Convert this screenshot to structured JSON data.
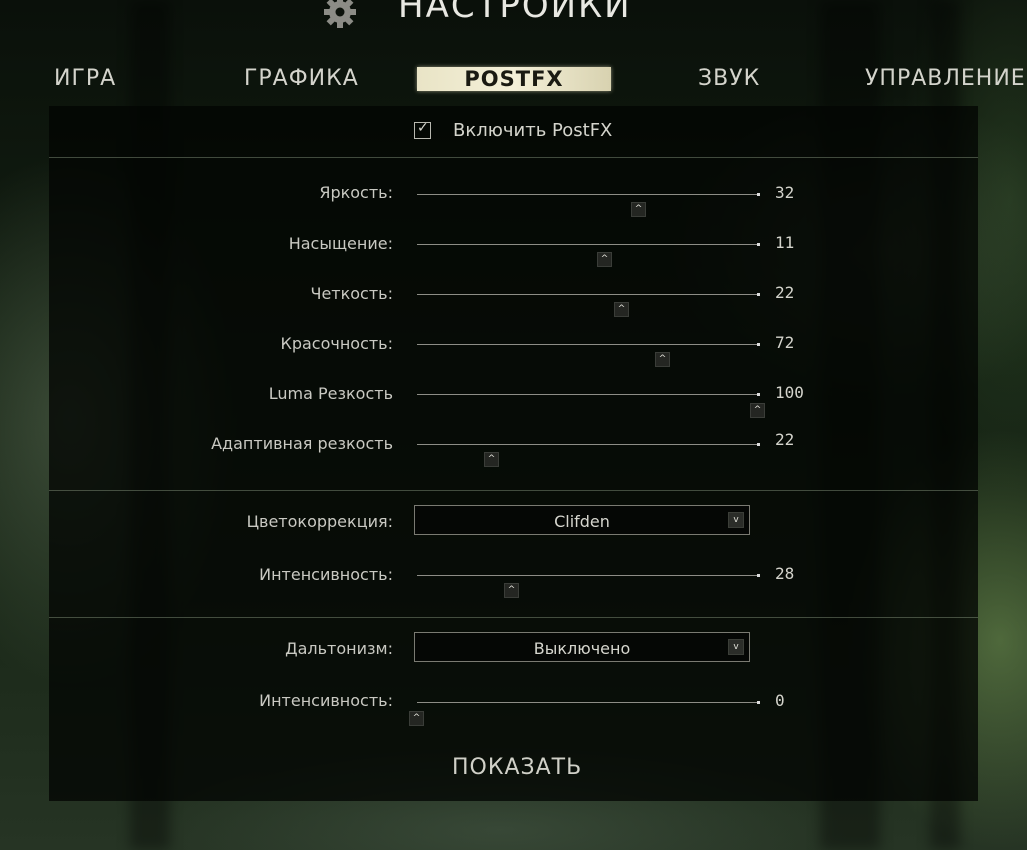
{
  "header": {
    "title": "НАСТРОЙКИ",
    "icon": "gear-icon"
  },
  "tabs": [
    {
      "label": "ИГРА",
      "active": false
    },
    {
      "label": "ГРАФИКА",
      "active": false
    },
    {
      "label": "POSTFX",
      "active": true
    },
    {
      "label": "ЗВУК",
      "active": false
    },
    {
      "label": "УПРАВЛЕНИЕ",
      "active": false
    }
  ],
  "postfx": {
    "enable_label": "Включить PostFX",
    "enabled": true,
    "check_glyph": "✓"
  },
  "sliders": [
    {
      "label": "Яркость:",
      "value": "32",
      "fraction": 0.65
    },
    {
      "label": "Насыщение:",
      "value": "11",
      "fraction": 0.55
    },
    {
      "label": "Четкость:",
      "value": "22",
      "fraction": 0.6
    },
    {
      "label": "Красочность:",
      "value": "72",
      "fraction": 0.72
    },
    {
      "label": "Luma Резкость",
      "value": "100",
      "fraction": 1.0
    },
    {
      "label": "Адаптивная резкость",
      "value": "22",
      "fraction": 0.22
    }
  ],
  "color_grading": {
    "label": "Цветокоррекция:",
    "selected": "Clifden",
    "intensity_label": "Интенсивность:",
    "intensity_value": "28",
    "intensity_fraction": 0.28
  },
  "colorblind": {
    "label": "Дальтонизм:",
    "selected": "Выключено",
    "intensity_label": "Интенсивность:",
    "intensity_value": "0",
    "intensity_fraction": 0.0
  },
  "show_button": "ПОКАЗАТЬ",
  "glyphs": {
    "thumb": "^",
    "dropdown": "v"
  }
}
